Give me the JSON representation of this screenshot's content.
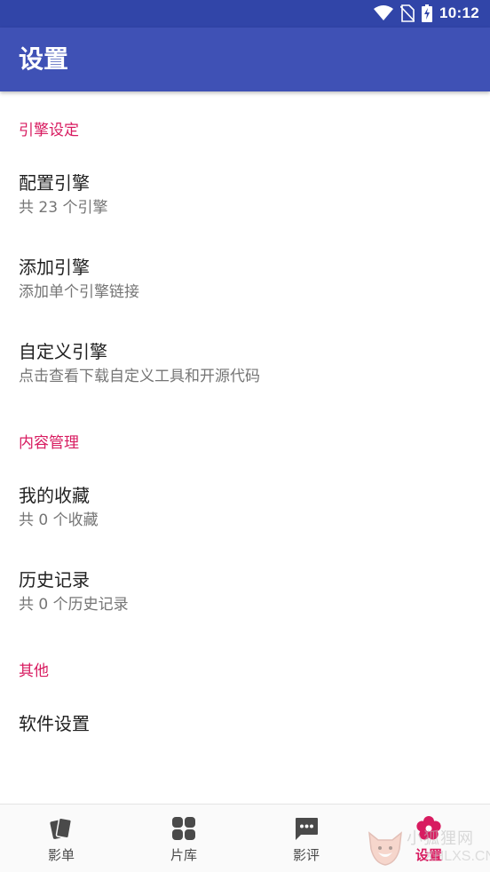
{
  "status_bar": {
    "time": "10:12"
  },
  "app_bar": {
    "title": "设置"
  },
  "sections": [
    {
      "header": "引擎设定",
      "items": [
        {
          "title": "配置引擎",
          "summary": "共 23 个引擎"
        },
        {
          "title": "添加引擎",
          "summary": "添加单个引擎链接"
        },
        {
          "title": "自定义引擎",
          "summary": "点击查看下载自定义工具和开源代码"
        }
      ]
    },
    {
      "header": "内容管理",
      "items": [
        {
          "title": "我的收藏",
          "summary": "共 0 个收藏"
        },
        {
          "title": "历史记录",
          "summary": "共 0 个历史记录"
        }
      ]
    },
    {
      "header": "其他",
      "items": [
        {
          "title": "软件设置"
        }
      ]
    }
  ],
  "bottom_nav": {
    "tabs": [
      {
        "label": "影单",
        "icon": "cards-icon"
      },
      {
        "label": "片库",
        "icon": "grid-icon"
      },
      {
        "label": "影评",
        "icon": "comment-icon"
      },
      {
        "label": "设置",
        "icon": "flower-icon",
        "active": true
      }
    ]
  },
  "watermark": {
    "line1": "小狐狸网",
    "line2": "XHLXS.CN"
  },
  "colors": {
    "primary": "#3f51b5",
    "primary_dark": "#3145a8",
    "accent": "#d81b60"
  }
}
